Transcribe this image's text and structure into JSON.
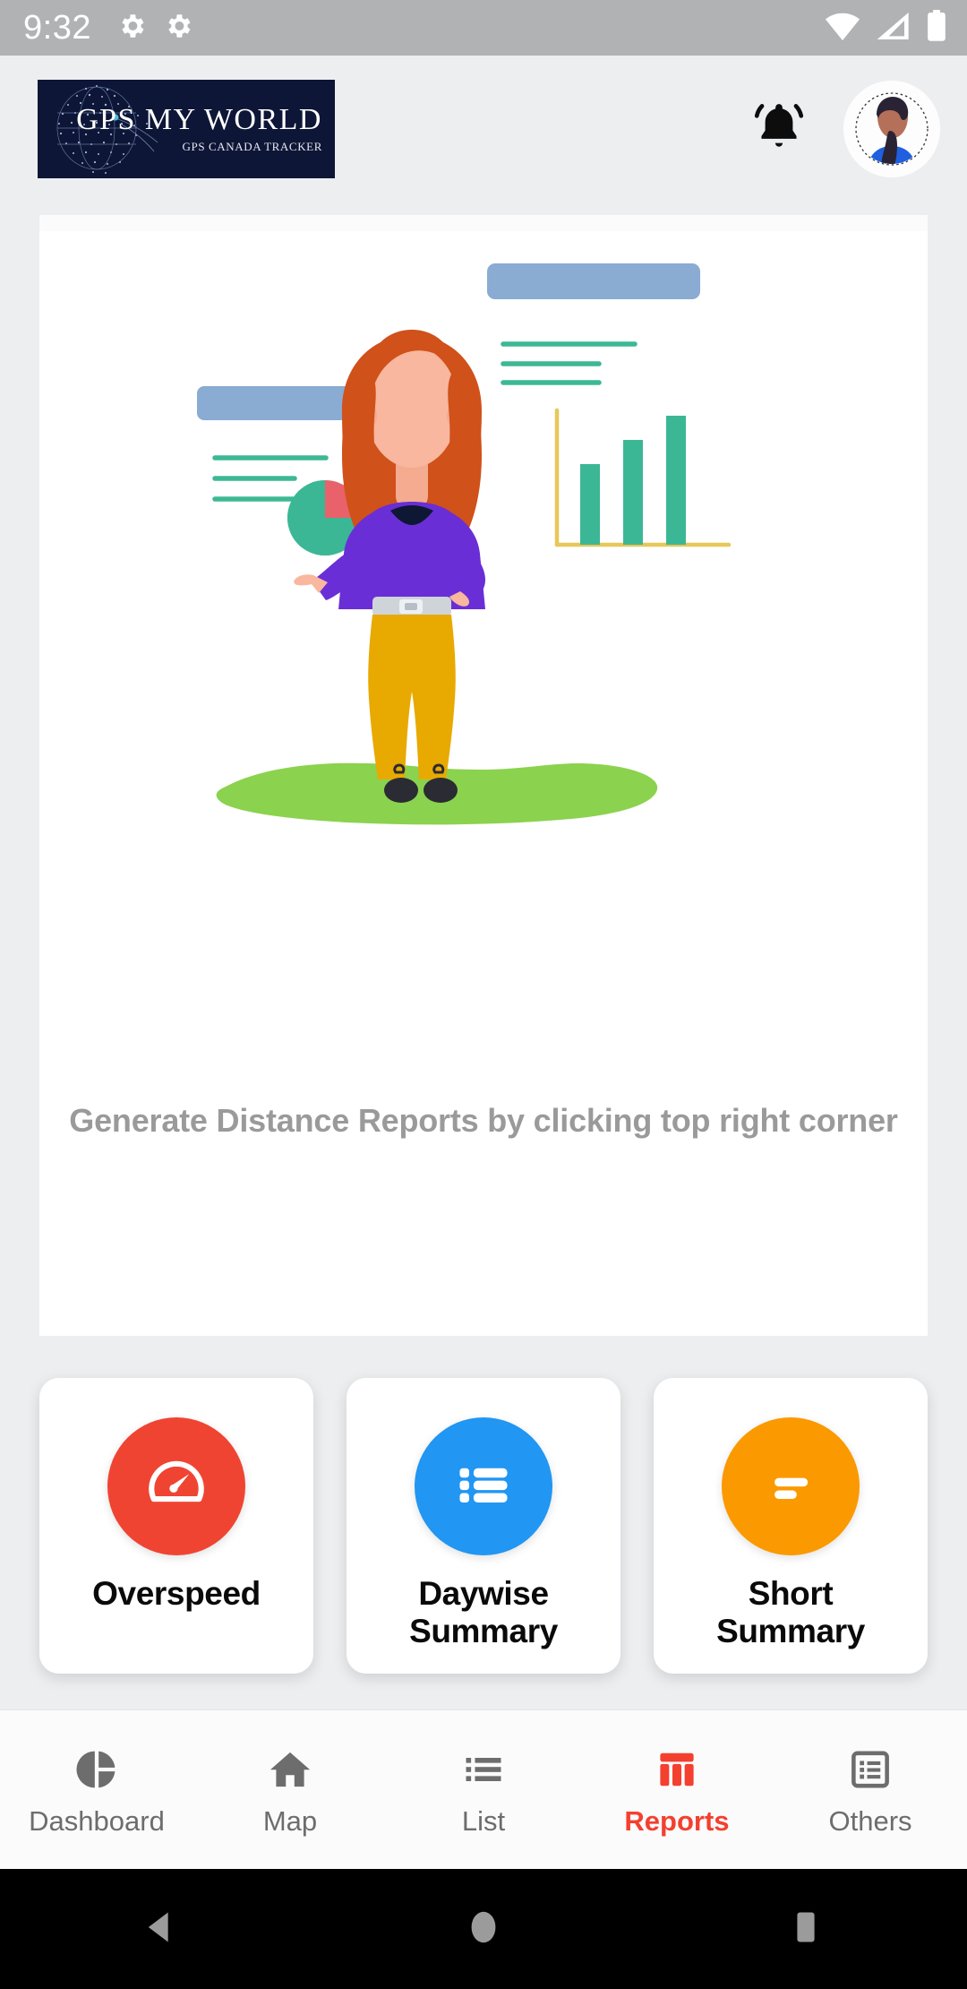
{
  "status_bar": {
    "time": "9:32",
    "left_icons": [
      "gear-icon",
      "gear-icon"
    ],
    "right_icons": [
      "wifi-icon",
      "cellular-signal-icon",
      "battery-icon"
    ]
  },
  "header": {
    "logo_title": "GPS MY WORLD",
    "logo_subtitle": "GPS CANADA TRACKER",
    "notification_icon": "bell-icon",
    "avatar_icon": "user-avatar"
  },
  "main": {
    "empty_state_caption": "Generate Distance Reports by clicking top right corner",
    "illustration": "woman-presenting-charts"
  },
  "action_cards": [
    {
      "label": "Overspeed",
      "icon": "speedometer-icon",
      "color": "#f04433"
    },
    {
      "label": "Daywise\nSummary",
      "label_line1": "Daywise",
      "label_line2": "Summary",
      "icon": "list-detail-icon",
      "color": "#2196f3"
    },
    {
      "label": "Short\nSummary",
      "label_line1": "Short",
      "label_line2": "Summary",
      "icon": "short-list-icon",
      "color": "#fb9900"
    }
  ],
  "bottom_nav": {
    "active": "Reports",
    "active_color": "#f4402f",
    "inactive_color": "#6d6d6d",
    "items": [
      {
        "label": "Dashboard",
        "icon": "pie-chart-icon"
      },
      {
        "label": "Map",
        "icon": "home-icon"
      },
      {
        "label": "List",
        "icon": "list-icon"
      },
      {
        "label": "Reports",
        "icon": "table-chart-icon"
      },
      {
        "label": "Others",
        "icon": "list-box-icon"
      }
    ]
  },
  "system_nav": {
    "buttons": [
      "back-triangle",
      "home-circle",
      "recents-square"
    ]
  },
  "colors": {
    "page_background": "#eceef0",
    "card_background": "#ffffff",
    "status_bar": "#b0b2b4",
    "accent_red": "#f4402f",
    "logo_navy": "#0d1636"
  }
}
